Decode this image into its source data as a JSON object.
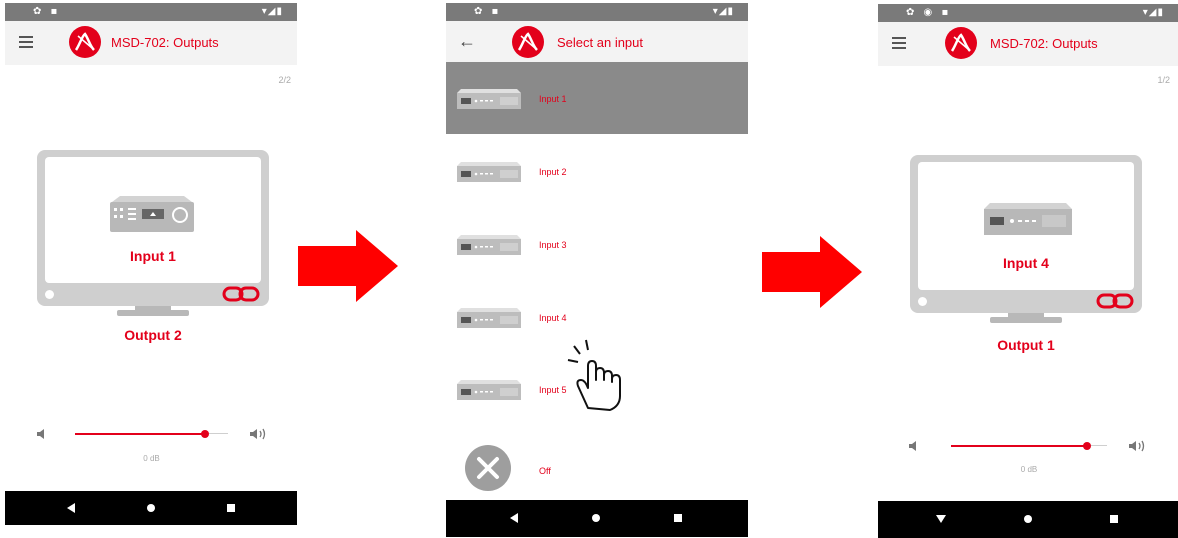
{
  "colors": {
    "accent": "#e3001b",
    "selected_row": "#8a8a8a",
    "statusbar": "#7a7a7a"
  },
  "screens": [
    {
      "title": "MSD-702: Outputs",
      "page_indicator": "2/2",
      "input_label": "Input 1",
      "output_label": "Output 2",
      "volume": "0 dB",
      "volume_level": 0.85,
      "icons": [
        "menu-icon",
        "kramer-logo",
        "speaker-low-icon",
        "speaker-high-icon",
        "link-icon"
      ]
    },
    {
      "title": "Select an input",
      "items": [
        {
          "label": "Input 1",
          "selected": true
        },
        {
          "label": "Input 2",
          "selected": false
        },
        {
          "label": "Input 3",
          "selected": false
        },
        {
          "label": "Input 4",
          "selected": false
        },
        {
          "label": "Input 5",
          "selected": false
        },
        {
          "label": "Off",
          "selected": false
        }
      ],
      "icons": [
        "back-arrow-icon",
        "kramer-logo",
        "hand-pointer-icon",
        "off-icon"
      ]
    },
    {
      "title": "MSD-702: Outputs",
      "page_indicator": "1/2",
      "input_label": "Input 4",
      "output_label": "Output 1",
      "volume": "0 dB",
      "volume_level": 0.87
    }
  ]
}
